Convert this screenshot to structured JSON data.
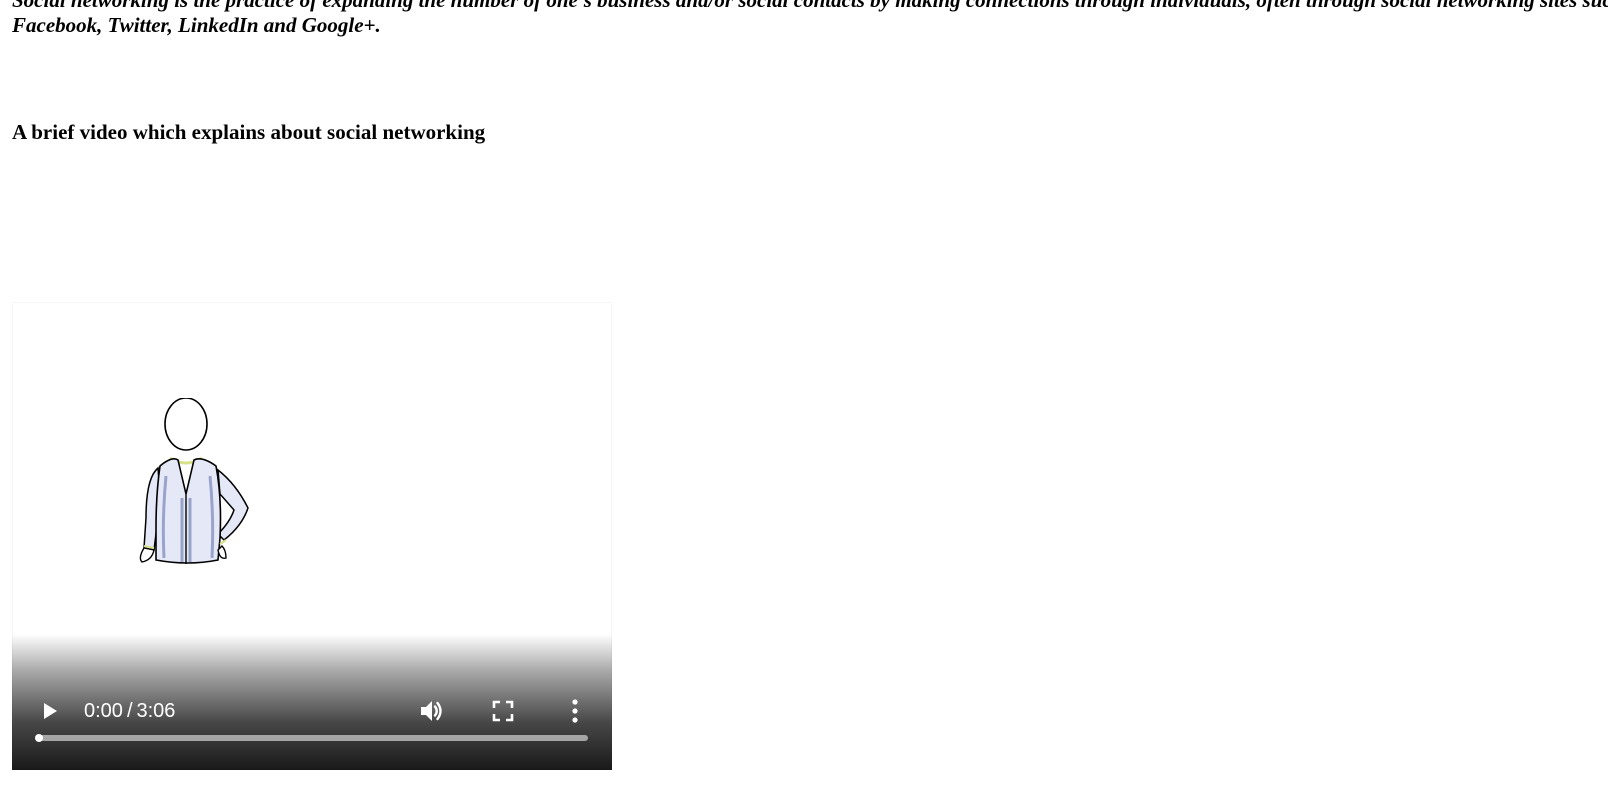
{
  "content": {
    "intro_line1": "Social networking is the practice of expanding the number of one's business and/or social contacts by making connections through individuals, often through social networking sites such as",
    "intro_line2": "Facebook, Twitter, LinkedIn and Google+.",
    "video_heading": "A brief video which explains about social networking"
  },
  "video": {
    "current_time": "0:00",
    "separator": "/",
    "duration": "3:06",
    "progress_fraction": 0,
    "icons": {
      "play": "play-icon",
      "volume": "volume-icon",
      "fullscreen": "fullscreen-icon",
      "menu": "more-options-icon",
      "poster": "person-figure-icon"
    }
  },
  "colors": {
    "text": "#000000",
    "controls_text": "#ffffff",
    "cardigan": "#e4e8f7",
    "cardigan_shade": "#9aa3c9",
    "collar_accent": "#d7e08a"
  }
}
